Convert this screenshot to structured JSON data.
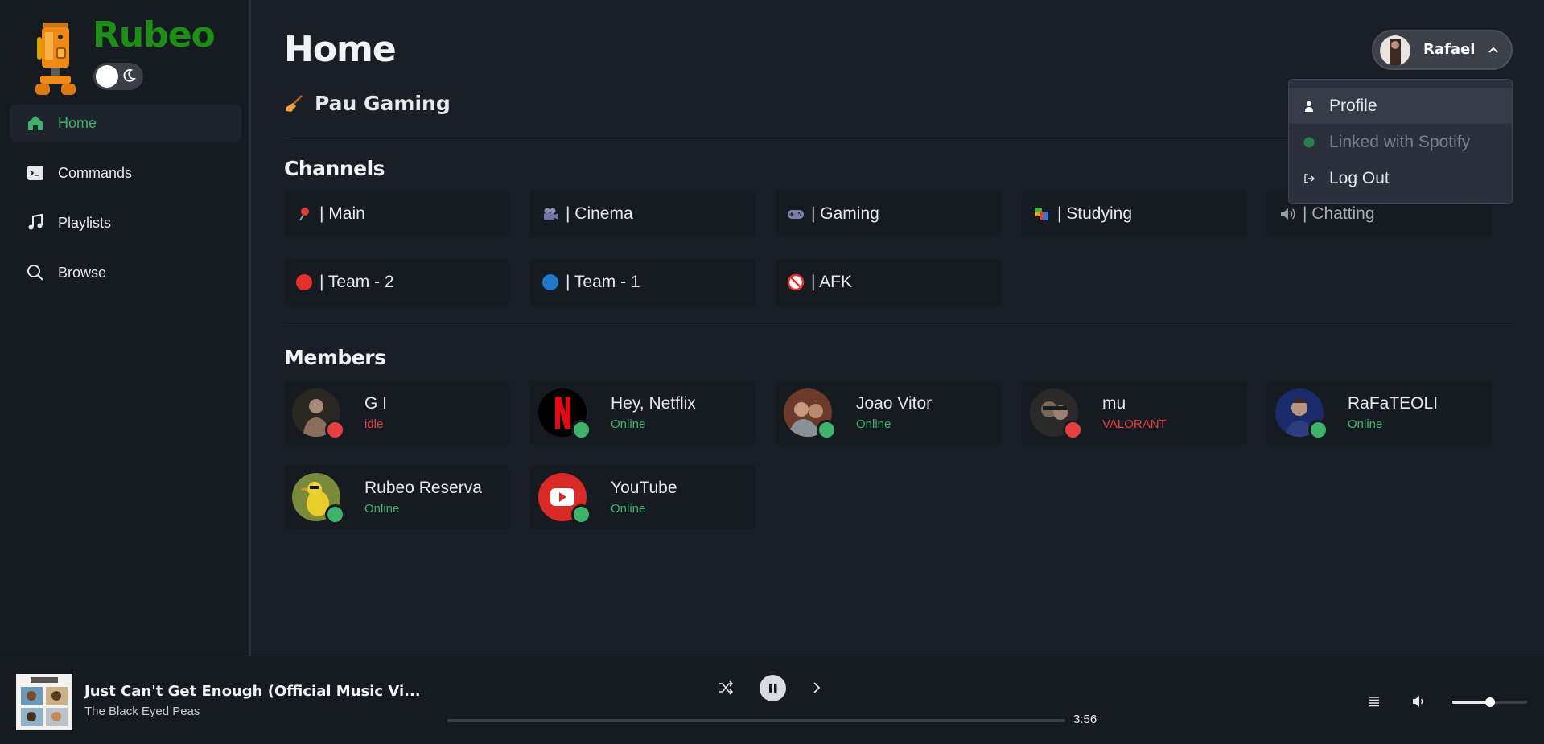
{
  "brand": {
    "name": "Rubeo"
  },
  "sidebar": {
    "items": [
      {
        "label": "Home",
        "icon": "home-icon",
        "active": true
      },
      {
        "label": "Commands",
        "icon": "terminal-icon",
        "active": false
      },
      {
        "label": "Playlists",
        "icon": "music-note-icon",
        "active": false
      },
      {
        "label": "Browse",
        "icon": "search-icon",
        "active": false
      }
    ]
  },
  "main": {
    "title": "Home",
    "guild": {
      "name": "Pau Gaming",
      "icon": "broom-icon"
    },
    "channels_title": "Channels",
    "channels": [
      {
        "label": "| Main",
        "icon": "pushpin-icon"
      },
      {
        "label": "| Cinema",
        "icon": "movie-camera-icon"
      },
      {
        "label": "| Gaming",
        "icon": "gamepad-icon"
      },
      {
        "label": "| Studying",
        "icon": "books-icon"
      },
      {
        "label": "| Chatting",
        "icon": "speaker-icon"
      },
      {
        "label": "| Team - 2",
        "icon": "red-circle-icon"
      },
      {
        "label": "| Team - 1",
        "icon": "blue-circle-icon"
      },
      {
        "label": "| AFK",
        "icon": "no-entry-icon"
      }
    ],
    "members_title": "Members",
    "members": [
      {
        "name": "G I",
        "status": "idle",
        "status_color": "#e5403f"
      },
      {
        "name": "Hey, Netflix",
        "status": "Online",
        "status_color": "#3fb36b"
      },
      {
        "name": "Joao Vitor",
        "status": "Online",
        "status_color": "#3fb36b"
      },
      {
        "name": "mu",
        "status": "VALORANT",
        "status_color": "#e5403f"
      },
      {
        "name": "RaFaTEOLI",
        "status": "Online",
        "status_color": "#3fb36b"
      },
      {
        "name": "Rubeo Reserva",
        "status": "Online",
        "status_color": "#3fb36b"
      },
      {
        "name": "YouTube",
        "status": "Online",
        "status_color": "#3fb36b"
      }
    ]
  },
  "user_menu": {
    "username": "Rafael",
    "items": [
      {
        "label": "Profile",
        "icon": "person-icon"
      },
      {
        "label": "Linked with Spotify",
        "icon": "spotify-dot-icon"
      },
      {
        "label": "Log Out",
        "icon": "logout-icon"
      }
    ]
  },
  "player": {
    "title": "Just Can't Get Enough (Official Music Vi...",
    "artist": "The Black Eyed Peas",
    "duration": "3:56",
    "progress": 0.0,
    "volume": 0.5
  },
  "colors": {
    "accent": "#3fb36b",
    "brand": "#1e8f16",
    "danger": "#e5403f"
  }
}
